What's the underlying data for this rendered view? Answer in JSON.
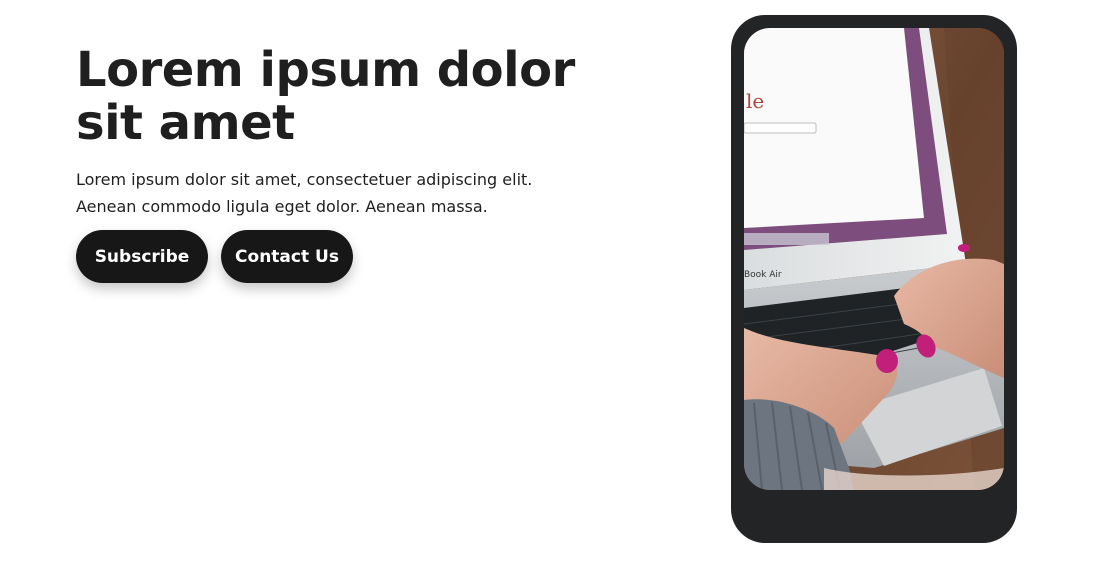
{
  "hero": {
    "title": "Lorem ipsum dolor sit amet",
    "description": "Lorem ipsum dolor sit amet, consectetuer adipiscing elit. Aenean commodo ligula eget dolor. Aenean massa.",
    "buttons": {
      "subscribe_label": "Subscribe",
      "contact_label": "Contact Us"
    }
  },
  "mockup": {
    "image_subject": "hands typing on laptop keyboard",
    "laptop_text": "Book Air"
  },
  "colors": {
    "button_bg": "#171717",
    "button_text": "#ffffff",
    "phone_frame": "#222426",
    "text": "#1f1f1f"
  }
}
